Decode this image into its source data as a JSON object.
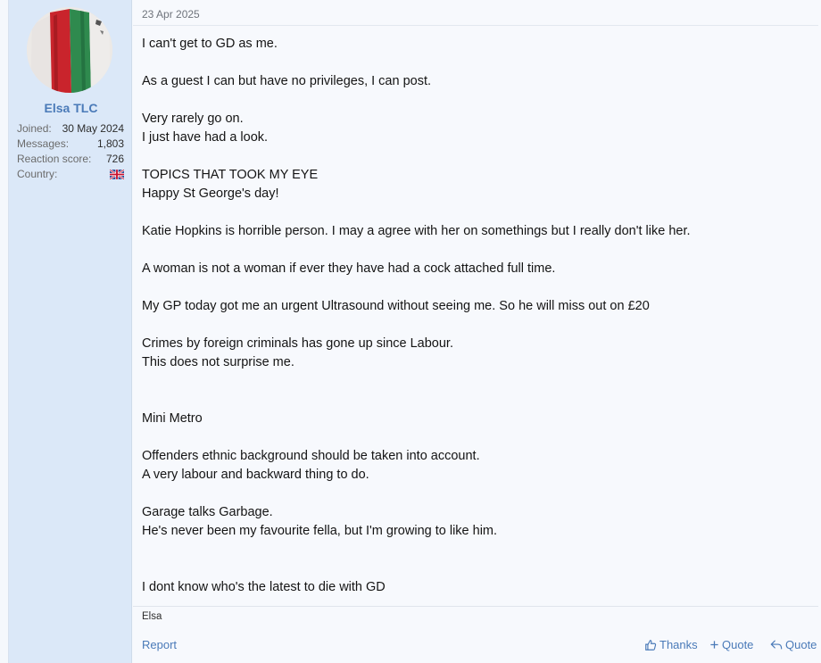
{
  "user": {
    "name": "Elsa TLC",
    "avatar": "avatar-photo",
    "stats": [
      {
        "label": "Joined:",
        "value": "30 May 2024"
      },
      {
        "label": "Messages:",
        "value": "1,803"
      },
      {
        "label": "Reaction score:",
        "value": "726"
      },
      {
        "label": "Country:",
        "value": "",
        "icon": "uk-flag-icon"
      }
    ]
  },
  "post": {
    "date": "23 Apr 2025",
    "lines": [
      "I can't get to GD as me.",
      "",
      "As a guest I can but have no privileges, I can post.",
      "",
      "Very rarely go on.",
      "I just have had a look.",
      "",
      "TOPICS THAT TOOK MY EYE",
      "Happy St George's day!",
      "",
      "Katie Hopkins is horrible person. I may a agree with her on somethings but I really don't like her.",
      "",
      "A woman is not a woman if ever they have had a cock attached full time.",
      "",
      "My GP today got me an urgent Ultrasound without seeing me. So he will miss out on £20",
      "",
      "Crimes by foreign criminals has gone up since Labour.",
      "This does not surprise me.",
      "",
      "",
      "Mini Metro",
      "",
      "Offenders ethnic background should be taken into account.",
      "A very labour and backward thing to do.",
      "",
      "Garage talks Garbage.",
      "He's never been my favourite fella, but I'm growing to like him.",
      "",
      "",
      "I dont know who's the latest to die with GD"
    ],
    "signature": "Elsa"
  },
  "actions": {
    "report": "Report",
    "thanks": "Thanks",
    "quote_add": "Quote",
    "quote": "Quote"
  },
  "colors": {
    "accent": "#4a7ab8",
    "sidebar_bg": "#dbe8f8",
    "message_bg": "#f7f9fd"
  }
}
